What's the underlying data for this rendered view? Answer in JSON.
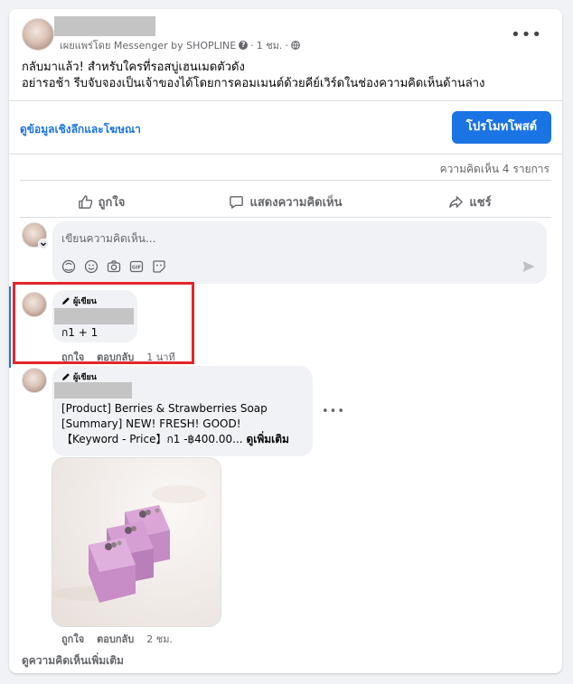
{
  "post": {
    "meta_text": "เผยแพร่โดย Messenger by SHOPLINE",
    "meta_sep": "·",
    "time": "1 ชม.",
    "more": "•••",
    "line1": "กลับมาแล้ว! สำหรับใครที่รอสบู่เฮนเมดตัวดัง",
    "line2": "อย่ารอช้า รีบจับจองเป็นเจ้าของได้โดยการคอมเมนต์ด้วยคีย์เวิร์ดในช่องความคิดเห็นด้านล่าง"
  },
  "insights_link": "ดูข้อมูลเชิงลึกและโฆษณา",
  "promote_button": "โปรโมทโพสต์",
  "comment_count": "ความคิดเห็น 4 รายการ",
  "actions": {
    "like": "ถูกใจ",
    "comment": "แสดงความคิดเห็น",
    "share": "แชร์"
  },
  "composer": {
    "placeholder": "เขียนความคิดเห็น..."
  },
  "comments": [
    {
      "author_tag": "ผู้เขียน",
      "text": "ก1 + 1",
      "like": "ถูกใจ",
      "reply": "ตอบกลับ",
      "time": "1 นาที"
    },
    {
      "author_tag": "ผู้เขียน",
      "line1": "[Product] Berries & Strawberries Soap",
      "line2": "[Summary] NEW! FRESH! GOOD!",
      "line3": "【Keyword - Price】ก1 -฿400.00...",
      "see_more": "ดูเพิ่มเติม",
      "more": "•••",
      "like": "ถูกใจ",
      "reply": "ตอบกลับ",
      "time": "2 ชม."
    }
  ],
  "view_more_comments": "ดูความคิดเห็นเพิ่มเติม",
  "colors": {
    "accent": "#1b74e4",
    "highlight": "#e3262b",
    "soap": "#c88cc6"
  }
}
